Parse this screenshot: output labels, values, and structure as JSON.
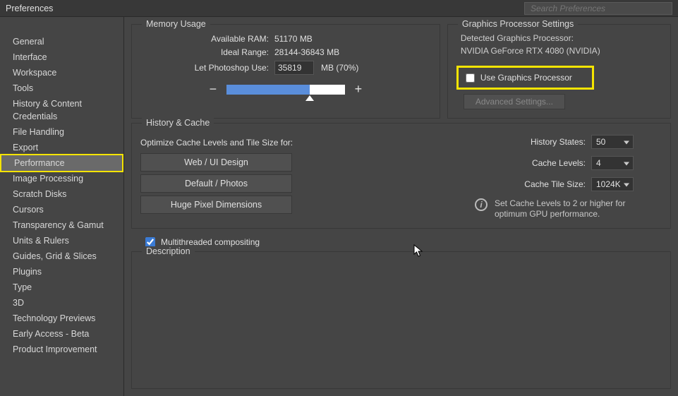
{
  "window": {
    "title": "Preferences",
    "search_placeholder": "Search Preferences"
  },
  "sidebar": {
    "items": [
      "General",
      "Interface",
      "Workspace",
      "Tools",
      "History & Content Credentials",
      "File Handling",
      "Export",
      "Performance",
      "Image Processing",
      "Scratch Disks",
      "Cursors",
      "Transparency & Gamut",
      "Units & Rulers",
      "Guides, Grid & Slices",
      "Plugins",
      "Type",
      "3D",
      "Technology Previews",
      "Early Access - Beta",
      "Product Improvement"
    ],
    "active_index": 7
  },
  "memory": {
    "title": "Memory Usage",
    "available_label": "Available RAM:",
    "available_value": "51170 MB",
    "ideal_label": "Ideal Range:",
    "ideal_value": "28144-36843 MB",
    "use_label": "Let Photoshop Use:",
    "use_value": "35819",
    "use_suffix": "MB (70%)",
    "slider_percent": 70,
    "minus": "−",
    "plus": "+"
  },
  "gpu": {
    "title": "Graphics Processor Settings",
    "detected_label": "Detected Graphics Processor:",
    "detected_value": "NVIDIA GeForce RTX 4080 (NVIDIA)",
    "use_checkbox_label": "Use Graphics Processor",
    "use_checkbox_checked": false,
    "advanced_button": "Advanced Settings..."
  },
  "history": {
    "title": "History & Cache",
    "optimize_label": "Optimize Cache Levels and Tile Size for:",
    "buttons": [
      "Web / UI Design",
      "Default / Photos",
      "Huge Pixel Dimensions"
    ],
    "history_states_label": "History States:",
    "history_states_value": "50",
    "cache_levels_label": "Cache Levels:",
    "cache_levels_value": "4",
    "cache_tile_label": "Cache Tile Size:",
    "cache_tile_value": "1024K",
    "info_text": "Set Cache Levels to 2 or higher for optimum GPU performance."
  },
  "multithread": {
    "label": "Multithreaded compositing",
    "checked": true
  },
  "description": {
    "title": "Description"
  }
}
